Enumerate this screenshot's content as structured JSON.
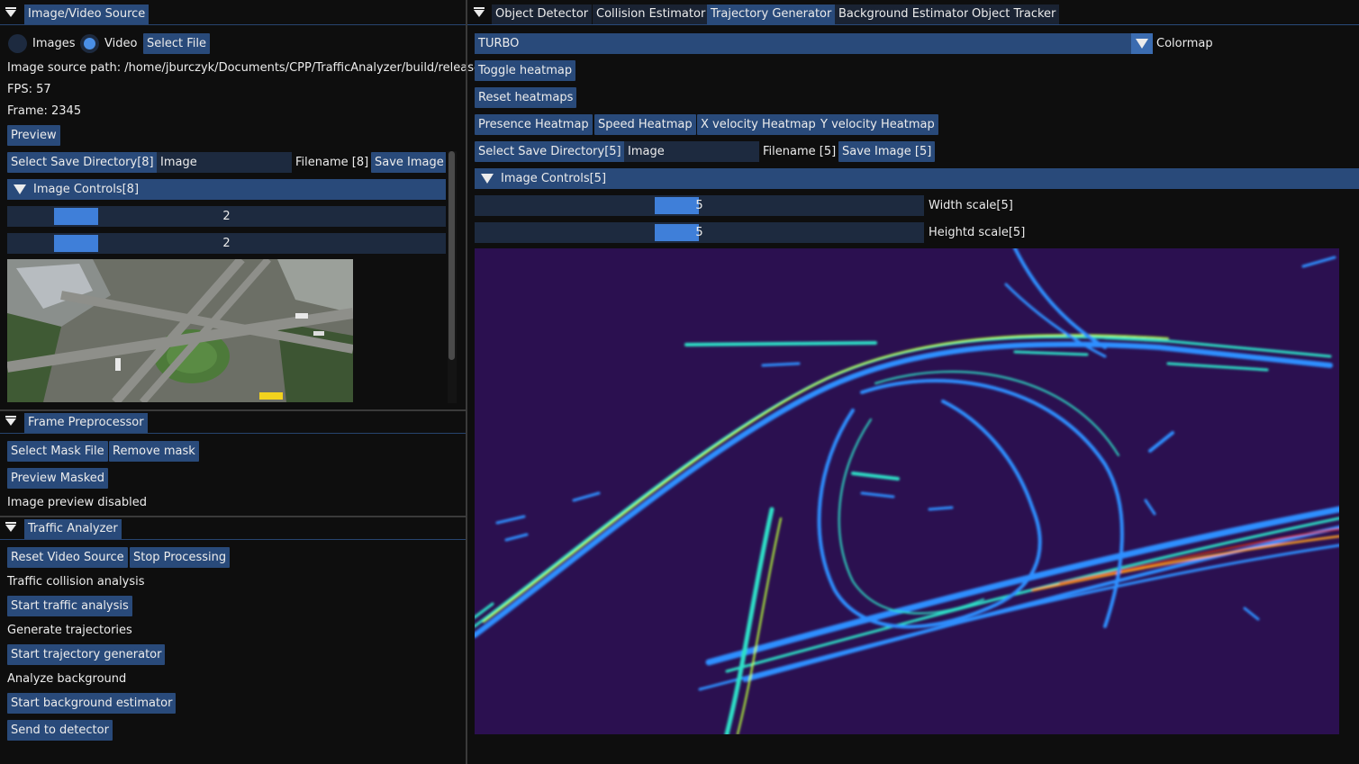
{
  "left": {
    "source": {
      "header": "Image/Video Source",
      "radio_images": "Images",
      "radio_video": "Video",
      "select_file": "Select File",
      "source_path": "Image source path: /home/jburczyk/Documents/CPP/TrafficAnalyzer/build/release",
      "fps": "FPS: 57",
      "frame": "Frame: 2345",
      "preview": "Preview",
      "select_save_dir": "Select Save Directory[8]",
      "image_input": "Image",
      "filename": "Filename [8]",
      "save_image": "Save Image [8]",
      "image_controls": "Image Controls[8]",
      "slider1": "2",
      "slider2": "2"
    },
    "preprocessor": {
      "header": "Frame Preprocessor",
      "select_mask": "Select Mask File",
      "remove_mask": "Remove mask",
      "preview_masked": "Preview Masked",
      "preview_status": "Image preview disabled"
    },
    "analyzer": {
      "header": "Traffic Analyzer",
      "reset_source": "Reset Video Source",
      "stop": "Stop Processing",
      "collision_label": "Traffic collision analysis",
      "start_traffic": "Start traffic analysis",
      "trajectories_label": "Generate trajectories",
      "start_trajectory": "Start trajectory generator",
      "background_label": "Analyze background",
      "start_background": "Start background estimator",
      "send_detector": "Send to detector"
    }
  },
  "right": {
    "tabs": [
      "Object Detector",
      "Collision Estimator",
      "Trajectory Generator",
      "Background Estimator",
      "Object Tracker"
    ],
    "active_tab": "Trajectory Generator",
    "colormap_value": "TURBO",
    "colormap_label": "Colormap",
    "toggle_heatmap": "Toggle heatmap",
    "reset_heatmaps": "Reset heatmaps",
    "presence_heatmap": "Presence Heatmap",
    "speed_heatmap": "Speed Heatmap",
    "xvel_heatmap": "X velocity Heatmap",
    "yvel_heatmap": "Y velocity Heatmap",
    "select_save_dir": "Select Save Directory[5]",
    "image_input": "Image",
    "filename": "Filename [5]",
    "save_image": "Save Image [5]",
    "image_controls": "Image Controls[5]",
    "width_value": "5",
    "width_label": "Width scale[5]",
    "height_value": "5",
    "height_label": "Heightd scale[5]"
  },
  "colors": {
    "button": "#294a7a",
    "heatmap_bg": "#2b1050",
    "accent": "#4a8fe6"
  }
}
